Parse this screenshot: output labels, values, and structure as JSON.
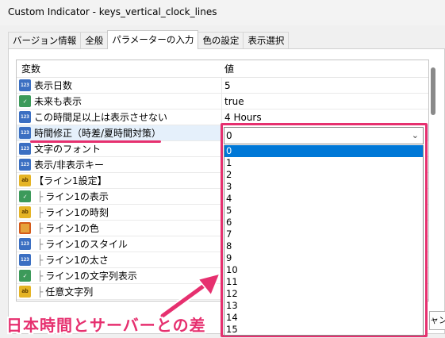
{
  "window": {
    "title": "Custom Indicator - keys_vertical_clock_lines"
  },
  "tabs": [
    {
      "label": "バージョン情報"
    },
    {
      "label": "全般"
    },
    {
      "label": "パラメーターの入力"
    },
    {
      "label": "色の設定"
    },
    {
      "label": "表示選択"
    }
  ],
  "grid": {
    "col_variable": "変数",
    "col_value": "値",
    "rows": [
      {
        "icon": "int-icon",
        "name": "表示日数",
        "value": "5"
      },
      {
        "icon": "bool-icon",
        "name": "未来も表示",
        "value": "true"
      },
      {
        "icon": "int-icon",
        "name": "この時間足以上は表示させない",
        "value": "4 Hours"
      },
      {
        "icon": "int-icon",
        "name": "時間修正（時差/夏時間対策）",
        "value": "0"
      },
      {
        "icon": "font-icon",
        "name": "文字のフォント",
        "value": ""
      },
      {
        "icon": "int-icon",
        "name": "表示/非表示キー",
        "value": ""
      },
      {
        "icon": "str-icon",
        "name": "【ライン1設定】",
        "value": ""
      },
      {
        "icon": "bool-icon",
        "prefix": "├",
        "name": "ライン1の表示",
        "value": ""
      },
      {
        "icon": "str-icon",
        "prefix": "├",
        "name": "ライン1の時刻",
        "value": ""
      },
      {
        "icon": "color-icon",
        "prefix": "├",
        "name": "ライン1の色",
        "value": ""
      },
      {
        "icon": "int-icon",
        "prefix": "├",
        "name": "ライン1のスタイル",
        "value": ""
      },
      {
        "icon": "int-icon",
        "prefix": "├",
        "name": "ライン1の太さ",
        "value": ""
      },
      {
        "icon": "bool-icon",
        "prefix": "├",
        "name": "ライン1の文字列表示",
        "value": ""
      },
      {
        "icon": "str-icon",
        "prefix": "├",
        "name": "任意文字列",
        "value": ""
      }
    ]
  },
  "dropdown": {
    "selected": "0",
    "options": [
      "0",
      "1",
      "2",
      "3",
      "4",
      "5",
      "6",
      "7",
      "8",
      "9",
      "10",
      "11",
      "12",
      "13",
      "14",
      "15"
    ]
  },
  "icon_text": {
    "int": "123",
    "bool": "✓",
    "str": "ab",
    "color": "",
    "font": "123"
  },
  "annotation": {
    "callout": "日本時間とサーバーとの差",
    "accent_color": "#e6306f"
  },
  "footer": {
    "cancel_partial": "ャン"
  }
}
